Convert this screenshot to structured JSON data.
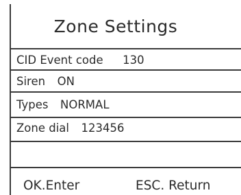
{
  "screen": {
    "title": "Zone Settings",
    "rows": [
      {
        "label": "CID Event code",
        "value": "130"
      },
      {
        "label": "Siren",
        "value": "ON"
      },
      {
        "label": "Types",
        "value": "NORMAL"
      },
      {
        "label": "Zone dial",
        "value": "123456"
      },
      {
        "label": "",
        "value": ""
      }
    ],
    "footer": {
      "ok_label": "OK.Enter",
      "esc_label": "ESC. Return"
    }
  }
}
